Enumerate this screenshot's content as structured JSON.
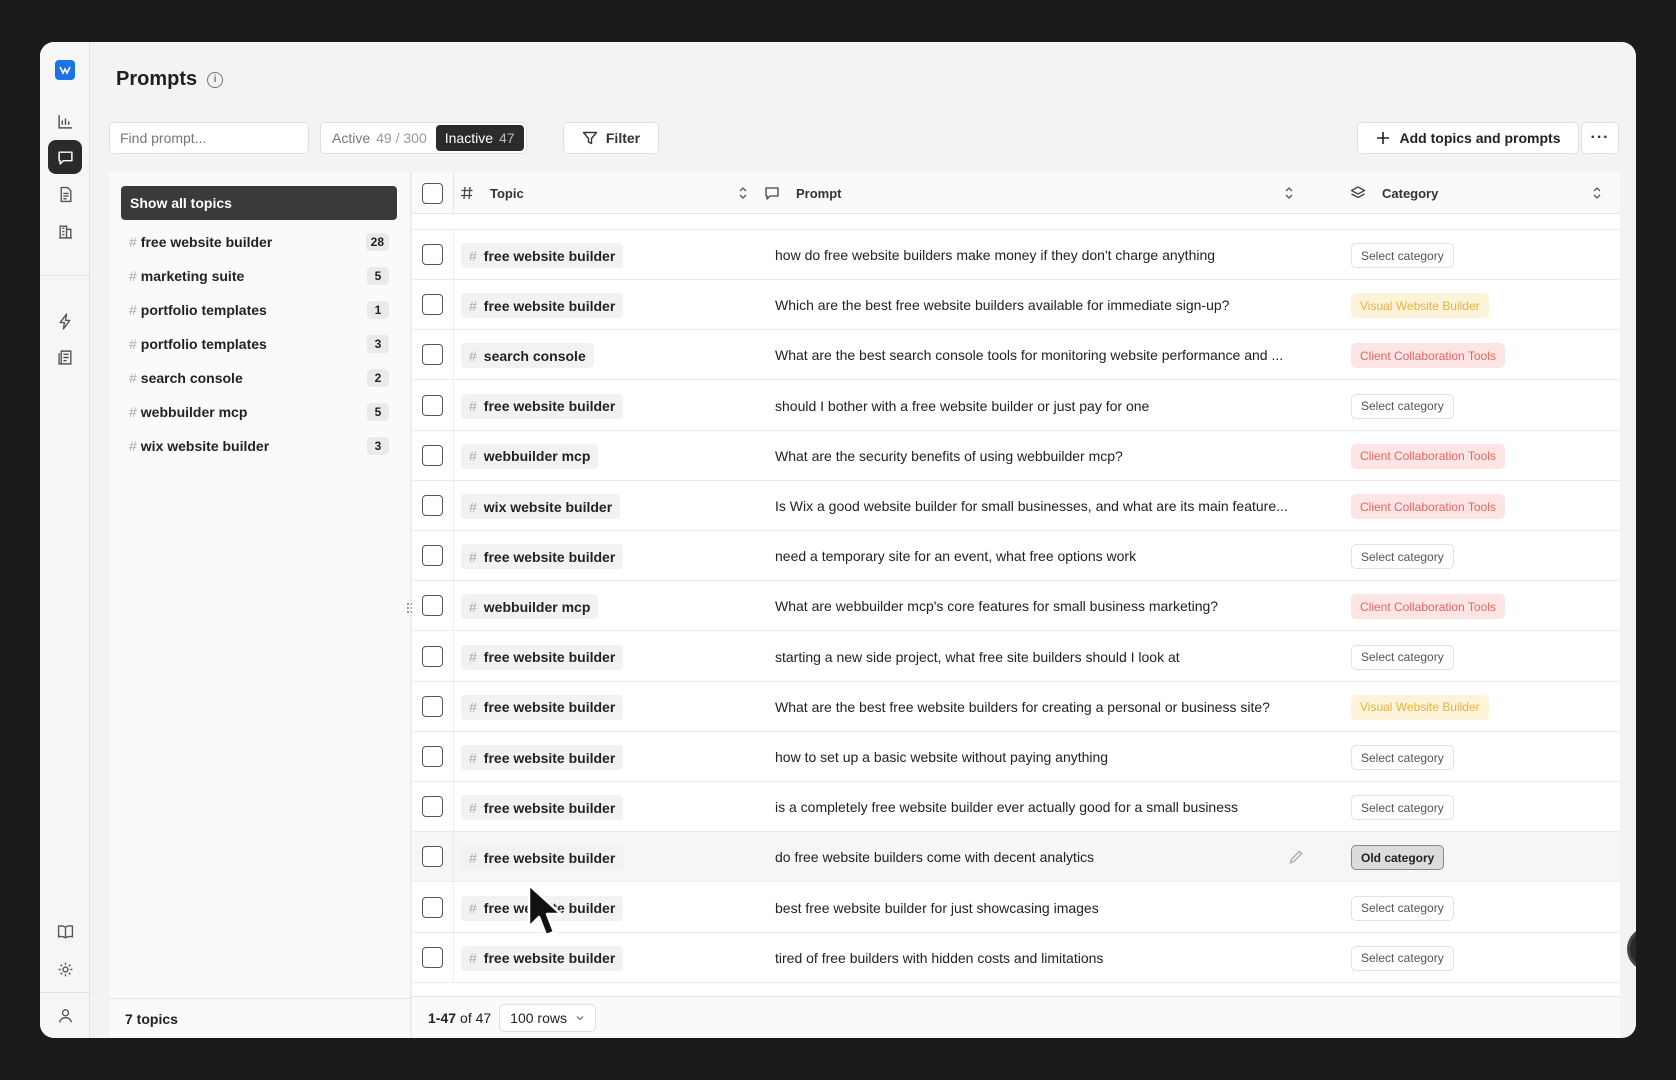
{
  "page": {
    "title": "Prompts"
  },
  "toolbar": {
    "search_placeholder": "Find prompt...",
    "active_label": "Active",
    "active_count": "49 / 300",
    "inactive_label": "Inactive",
    "inactive_count": "47",
    "filter_label": "Filter",
    "add_label": "Add topics and prompts",
    "more_label": "···"
  },
  "topics_panel": {
    "show_all": "Show all topics",
    "items": [
      {
        "name": "free website builder",
        "count": "28"
      },
      {
        "name": "marketing suite",
        "count": "5"
      },
      {
        "name": "portfolio templates",
        "count": "1"
      },
      {
        "name": "portfolio templates",
        "count": "3"
      },
      {
        "name": "search console",
        "count": "2"
      },
      {
        "name": "webbuilder mcp",
        "count": "5"
      },
      {
        "name": "wix website builder",
        "count": "3"
      }
    ],
    "footer": "7 topics"
  },
  "table": {
    "headers": {
      "topic": "Topic",
      "prompt": "Prompt",
      "category": "Category"
    },
    "rows": [
      {
        "topic": "free website builder",
        "prompt": "how do free website builders make money if they don't charge anything",
        "category": "Select category",
        "style": "none"
      },
      {
        "topic": "free website builder",
        "prompt": "Which are the best free website builders available for immediate sign-up?",
        "category": "Visual Website Builder",
        "style": "yellow"
      },
      {
        "topic": "search console",
        "prompt": "What are the best search console tools for monitoring website performance and ...",
        "category": "Client Collaboration Tools",
        "style": "red"
      },
      {
        "topic": "free website builder",
        "prompt": "should I bother with a free website builder or just pay for one",
        "category": "Select category",
        "style": "none"
      },
      {
        "topic": "webbuilder mcp",
        "prompt": "What are the security benefits of using webbuilder mcp?",
        "category": "Client Collaboration Tools",
        "style": "red"
      },
      {
        "topic": "wix website builder",
        "prompt": "Is Wix a good website builder for small businesses, and what are its main feature...",
        "category": "Client Collaboration Tools",
        "style": "red"
      },
      {
        "topic": "free website builder",
        "prompt": "need a temporary site for an event, what free options work",
        "category": "Select category",
        "style": "none"
      },
      {
        "topic": "webbuilder mcp",
        "prompt": "What are webbuilder mcp's core features for small business marketing?",
        "category": "Client Collaboration Tools",
        "style": "red"
      },
      {
        "topic": "free website builder",
        "prompt": "starting a new side project, what free site builders should I look at",
        "category": "Select category",
        "style": "none"
      },
      {
        "topic": "free website builder",
        "prompt": "What are the best free website builders for creating a personal or business site?",
        "category": "Visual Website Builder",
        "style": "yellow"
      },
      {
        "topic": "free website builder",
        "prompt": "how to set up a basic website without paying anything",
        "category": "Select category",
        "style": "none"
      },
      {
        "topic": "free website builder",
        "prompt": "is a completely free website builder ever actually good for a small business",
        "category": "Select category",
        "style": "none"
      },
      {
        "topic": "free website builder",
        "prompt": "do free website builders come with decent analytics",
        "category": "Old category",
        "style": "dark"
      },
      {
        "topic": "free website builder",
        "prompt": "best free website builder for just showcasing images",
        "category": "Select category",
        "style": "none"
      },
      {
        "topic": "free website builder",
        "prompt": "tired of free builders with hidden costs and limitations",
        "category": "Select category",
        "style": "none"
      }
    ],
    "pagination": {
      "range": "1-47",
      "of": "of 47",
      "rows_per_page": "100 rows"
    }
  }
}
